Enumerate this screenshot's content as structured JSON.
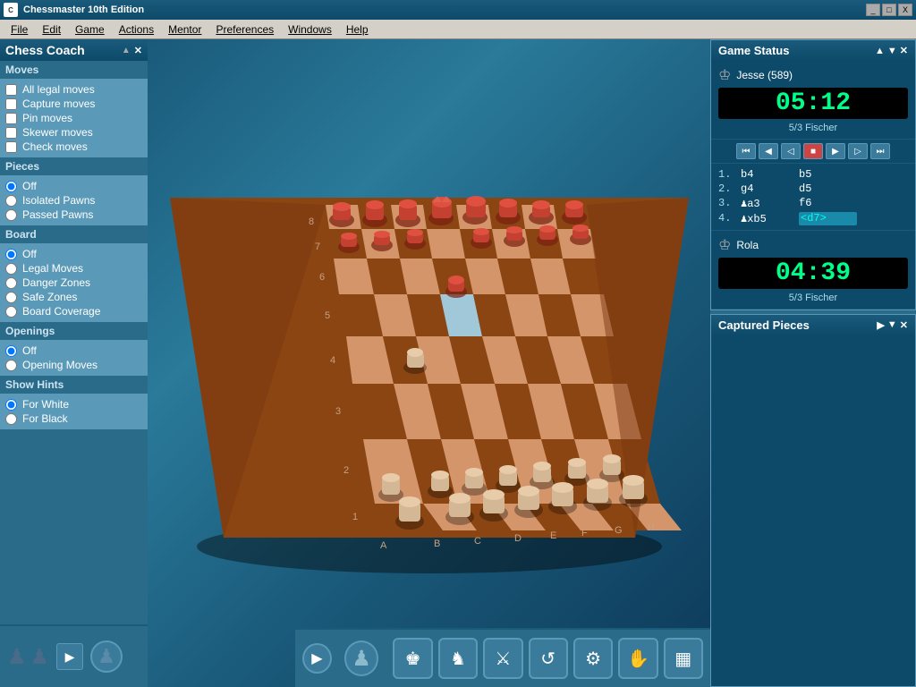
{
  "titlebar": {
    "app_name": "Chessmaster 10th Edition",
    "minimize": "_",
    "maximize": "□",
    "close": "X"
  },
  "menubar": {
    "items": [
      "File",
      "Edit",
      "Game",
      "Actions",
      "Mentor",
      "Preferences",
      "Windows",
      "Help"
    ]
  },
  "chess_coach": {
    "title": "Chess Coach",
    "sections": {
      "moves": {
        "label": "Moves",
        "items": [
          {
            "label": "All legal moves",
            "checked": false
          },
          {
            "label": "Capture moves",
            "checked": false
          },
          {
            "label": "Pin moves",
            "checked": false
          },
          {
            "label": "Skewer moves",
            "checked": false
          },
          {
            "label": "Check moves",
            "checked": false
          }
        ]
      },
      "pieces": {
        "label": "Pieces",
        "items": [
          {
            "label": "Off",
            "selected": true
          },
          {
            "label": "Isolated Pawns",
            "selected": false
          },
          {
            "label": "Passed Pawns",
            "selected": false
          }
        ]
      },
      "board": {
        "label": "Board",
        "items": [
          {
            "label": "Off",
            "selected": true
          },
          {
            "label": "Legal Moves",
            "selected": false
          },
          {
            "label": "Danger Zones",
            "selected": false
          },
          {
            "label": "Safe Zones",
            "selected": false
          },
          {
            "label": "Board Coverage",
            "selected": false
          }
        ]
      },
      "openings": {
        "label": "Openings",
        "items": [
          {
            "label": "Off",
            "selected": true
          },
          {
            "label": "Opening Moves",
            "selected": false
          }
        ]
      },
      "show_hints": {
        "label": "Show Hints",
        "items": [
          {
            "label": "For White",
            "selected": true
          },
          {
            "label": "For Black",
            "selected": false
          }
        ]
      }
    }
  },
  "game_status": {
    "title": "Game Status",
    "player1": {
      "name": "Jesse (589)",
      "timer": "05:12",
      "rating": "5/3 Fischer"
    },
    "player2": {
      "name": "Rola",
      "timer": "04:39",
      "rating": "5/3 Fischer"
    },
    "moves": [
      {
        "num": "1.",
        "white": "b4",
        "black": "b5"
      },
      {
        "num": "2.",
        "white": "g4",
        "black": "d5"
      },
      {
        "num": "3.",
        "white": "♟a3",
        "black": "f6"
      },
      {
        "num": "4.",
        "white": "♟xb5",
        "black": "<d7>"
      }
    ]
  },
  "captured_pieces": {
    "title": "Captured Pieces"
  },
  "toolbar": {
    "buttons": [
      "♟",
      "♟",
      "⚔",
      "♞",
      "♛",
      "✋",
      "▦"
    ]
  }
}
